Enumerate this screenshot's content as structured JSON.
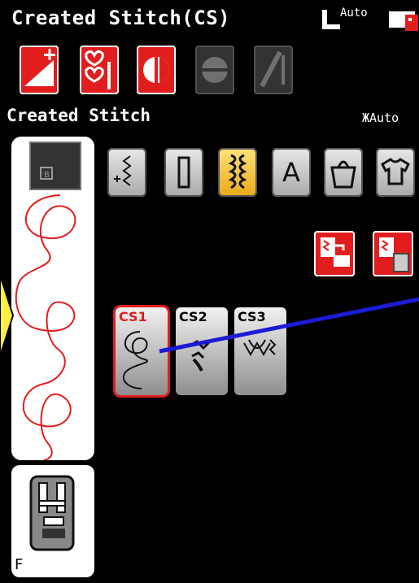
{
  "header": {
    "title": "Created Stitch(CS)",
    "auto_label": "Auto"
  },
  "toolbar": {
    "buttons": [
      {
        "name": "stitch-length-button",
        "icon": "stitch-length-plus-icon"
      },
      {
        "name": "mirror-hearts-button",
        "icon": "mirror-hearts-icon"
      },
      {
        "name": "balance-button",
        "icon": "balance-icon"
      },
      {
        "name": "pattern-end-button",
        "icon": "pattern-end-icon"
      },
      {
        "name": "needle-stop-button",
        "icon": "needle-stop-icon"
      }
    ]
  },
  "section": {
    "title": "Created Stitch",
    "thread_tension": "Auto"
  },
  "categories": [
    {
      "name": "utility-stitches",
      "icon": "utility-stitch-icon"
    },
    {
      "name": "buttonholes",
      "icon": "buttonhole-icon"
    },
    {
      "name": "decorative-stitches",
      "icon": "decorative-stitch-icon",
      "selected": true
    },
    {
      "name": "alphabets",
      "label": "A"
    },
    {
      "name": "quilt-stitches",
      "icon": "quilt-bag-icon"
    },
    {
      "name": "garment-stitches",
      "icon": "tshirt-icon"
    }
  ],
  "actions": [
    {
      "name": "load-to-memory",
      "icon": "load-to-machine-icon"
    },
    {
      "name": "delete-from-memory",
      "icon": "delete-trash-icon"
    }
  ],
  "stitches": [
    {
      "label": "CS1",
      "selected": true
    },
    {
      "label": "CS2"
    },
    {
      "label": "CS3"
    }
  ],
  "presser_foot": {
    "letter": "F"
  },
  "colors": {
    "accent_red": "#e21d1d",
    "selected_yellow": "#f3c02f",
    "pointer_blue": "#1b1bd6",
    "arrow_yellow": "#ffee44"
  }
}
